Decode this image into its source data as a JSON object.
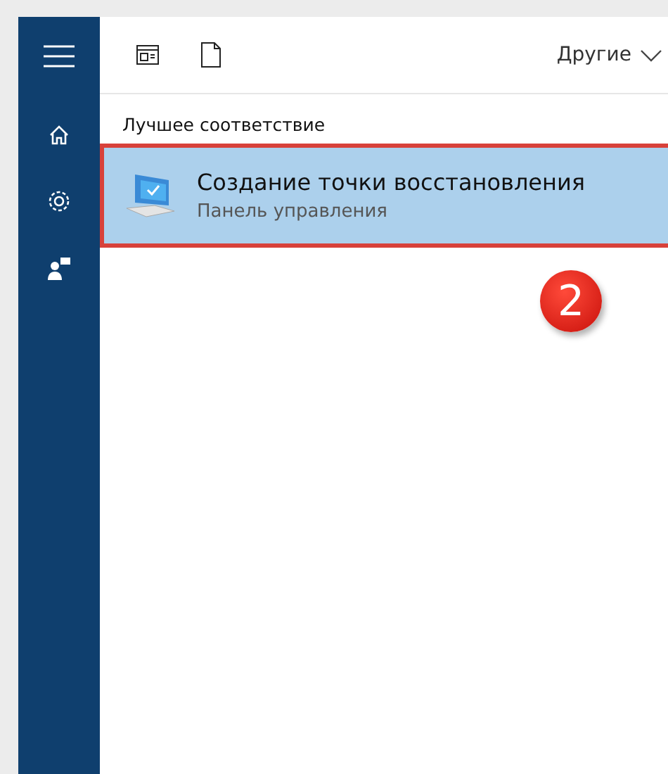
{
  "toolbar": {
    "filter": "Другие"
  },
  "section": {
    "title": "Лучшее соответствие"
  },
  "results": [
    {
      "title": "Создание точки восстановления",
      "subtitle": "Панель управления",
      "selected": true
    }
  ],
  "annotation": {
    "badge": "2"
  }
}
